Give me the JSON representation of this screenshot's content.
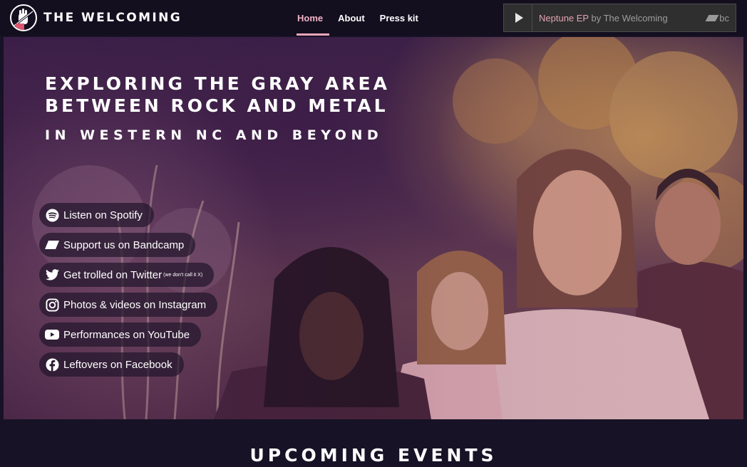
{
  "brand": {
    "name": "THE WELCOMING"
  },
  "nav": [
    {
      "label": "Home",
      "active": true
    },
    {
      "label": "About",
      "active": false
    },
    {
      "label": "Press kit",
      "active": false
    }
  ],
  "player": {
    "album": "Neptune EP",
    "by": "by The Welcoming",
    "badge": "bc"
  },
  "hero": {
    "headline_line1": "EXPLORING THE GRAY AREA",
    "headline_line2": "BETWEEN ROCK AND METAL",
    "subline": "IN WESTERN NC AND BEYOND"
  },
  "links": [
    {
      "icon": "spotify-icon",
      "label": "Listen on Spotify",
      "note": ""
    },
    {
      "icon": "bandcamp-icon",
      "label": "Support us on Bandcamp",
      "note": ""
    },
    {
      "icon": "twitter-icon",
      "label": "Get trolled on Twitter",
      "note": "(we don't call it X)"
    },
    {
      "icon": "instagram-icon",
      "label": "Photos & videos on Instagram",
      "note": ""
    },
    {
      "icon": "youtube-icon",
      "label": "Performances on YouTube",
      "note": ""
    },
    {
      "icon": "facebook-icon",
      "label": "Leftovers on Facebook",
      "note": ""
    }
  ],
  "events": {
    "title": "UPCOMING EVENTS"
  },
  "colors": {
    "accent": "#e9a6b8",
    "header_bg": "#130f1f",
    "page_bg": "#171226"
  }
}
